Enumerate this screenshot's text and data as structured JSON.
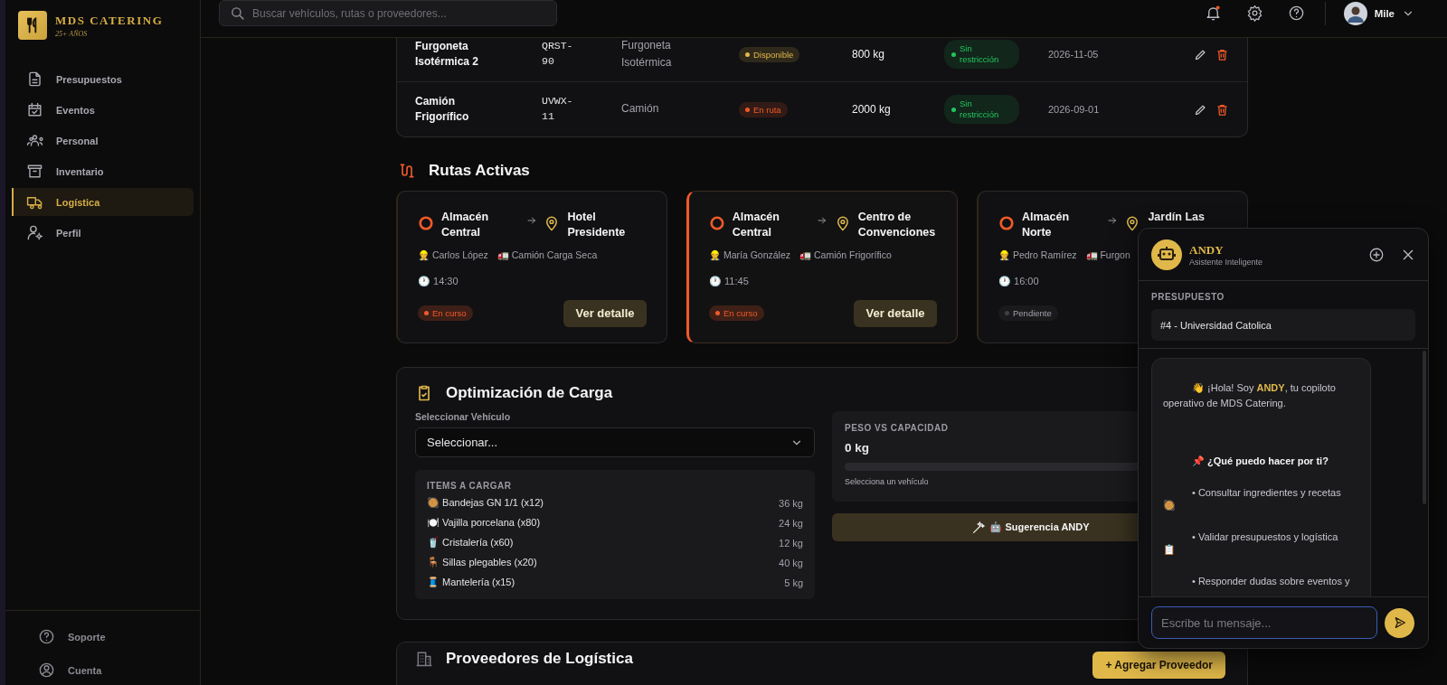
{
  "sidebar": {
    "brand": "MDS CATERING",
    "tagline": "25+ AÑOS",
    "items": [
      {
        "label": "Presupuestos",
        "selected": false
      },
      {
        "label": "Eventos",
        "selected": false
      },
      {
        "label": "Personal",
        "selected": false
      },
      {
        "label": "Inventario",
        "selected": false
      },
      {
        "label": "Logística",
        "selected": true
      },
      {
        "label": "Perfil",
        "selected": false
      }
    ],
    "footer_items": [
      {
        "label": "Soporte"
      },
      {
        "label": "Cuenta"
      }
    ]
  },
  "topbar": {
    "search": {
      "placeholder": "Buscar vehículos, rutas o proveedores..."
    },
    "user": {
      "name": "Mile"
    }
  },
  "vehicles": {
    "rows": [
      {
        "name": "Furgoneta Isotérmica 2",
        "plate": "QRST-90",
        "type": "Furgoneta Isotérmica",
        "status": {
          "label": "Disponible",
          "color": "#e0b84a"
        },
        "capacity": "800 kg",
        "restriction": {
          "label": "Sin restricción",
          "color": "#22c55e"
        },
        "date": "2026-11-05"
      },
      {
        "name": "Camión Frigorífico",
        "plate": "UVWX-11",
        "type": "Camión",
        "status": {
          "label": "En ruta",
          "color": "#f05a28"
        },
        "capacity": "2000 kg",
        "restriction": {
          "label": "Sin restricción",
          "color": "#22c55e"
        },
        "date": "2026-09-01"
      }
    ]
  },
  "routes": {
    "title": "Rutas Activas",
    "items": [
      {
        "origin": "Almacén Central",
        "destination": "Hotel Presidente",
        "driver": "👷 Carlos López",
        "vehicle": "🚛 Camión Carga Seca",
        "time": "🕐 14:30",
        "status": {
          "label": "En curso",
          "color": "#f05a28"
        },
        "action": "Ver detalle",
        "selected": false
      },
      {
        "origin": "Almacén Central",
        "destination": "Centro de Convenciones",
        "driver": "👷 María González",
        "vehicle": "🚛 Camión Frigorífico",
        "time": "🕐 11:45",
        "status": {
          "label": "En curso",
          "color": "#f05a28"
        },
        "action": "Ver detalle",
        "selected": true
      },
      {
        "origin": "Almacén Norte",
        "destination": "Jardín Las",
        "driver": "👷 Pedro Ramírez",
        "vehicle": "🚛 Furgon",
        "time": "🕐 16:00",
        "status": {
          "label": "Pendiente",
          "color": "#3f3f46"
        },
        "selected": false
      }
    ]
  },
  "load_optimization": {
    "title": "Optimización de Carga",
    "vehicle_label": "Seleccionar Vehículo",
    "vehicle_select": "Seleccionar...",
    "items_title": "ITEMS A CARGAR",
    "items": [
      {
        "name": "🥘 Bandejas GN 1/1 (x12)",
        "weight": "36 kg"
      },
      {
        "name": "🍽️ Vajilla porcelana (x80)",
        "weight": "24 kg"
      },
      {
        "name": "🥤 Cristalería (x60)",
        "weight": "12 kg"
      },
      {
        "name": "🪑 Sillas plegables (x20)",
        "weight": "40 kg"
      },
      {
        "name": "🧵 Mantelería (x15)",
        "weight": "5 kg"
      }
    ],
    "capacity_title": "PESO VS CAPACIDAD",
    "weight": "0 kg",
    "level": 0,
    "capacity_hint": "Selecciona un vehículo",
    "suggest_button": "🤖 Sugerencia ANDY"
  },
  "providers": {
    "title": "Proveedores de Logística",
    "add_button": "+ Agregar Proveedor"
  },
  "assistant": {
    "name": "ANDY",
    "subtitle": "Asistente Inteligente",
    "budget_label": "PRESUPUESTO",
    "budget": "#4 - Universidad Catolica",
    "greeting": "👋 ¡Hola! Soy **ANDY**, tu copiloto operativo de MDS Catering.",
    "heading": "📌 ¿Qué puedo hacer por ti?",
    "bullets": [
      {
        "text": "• Consultar ingredientes y recetas",
        "emoji": "🥘"
      },
      {
        "text": "• Validar presupuestos y logística",
        "emoji": "📋"
      },
      {
        "text": "• Responder dudas sobre eventos y"
      }
    ],
    "input": {
      "placeholder": "Escribe tu mensaje..."
    }
  }
}
